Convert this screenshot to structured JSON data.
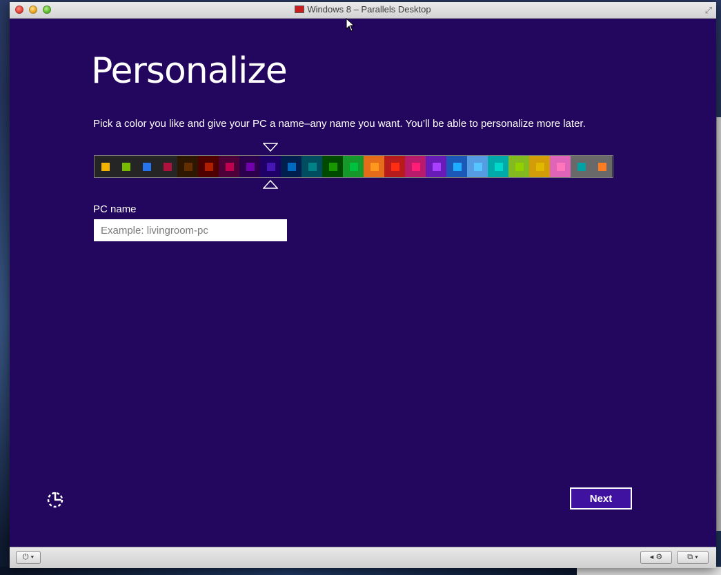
{
  "window": {
    "title": "Windows 8 – Parallels Desktop"
  },
  "page": {
    "heading": "Personalize",
    "subtitle": "Pick a color you like and give your PC a name–any name you want. You’ll be able to personalize more later.",
    "pc_name_label": "PC name",
    "pc_name_value": "",
    "pc_name_placeholder": "Example: livingroom-pc",
    "next_label": "Next",
    "selected_color_index": 8
  },
  "color_swatches": [
    {
      "bg": "#252525",
      "chip": "#f4b300"
    },
    {
      "bg": "#252525",
      "chip": "#78ba00"
    },
    {
      "bg": "#252525",
      "chip": "#2673ec"
    },
    {
      "bg": "#252525",
      "chip": "#ae113d"
    },
    {
      "bg": "#2e1700",
      "chip": "#632f00"
    },
    {
      "bg": "#4e0000",
      "chip": "#b01e00"
    },
    {
      "bg": "#4e0038",
      "chip": "#c1004f"
    },
    {
      "bg": "#2d004e",
      "chip": "#7200ac"
    },
    {
      "bg": "#1f0068",
      "chip": "#4617b4"
    },
    {
      "bg": "#001e4e",
      "chip": "#006ac1"
    },
    {
      "bg": "#004d60",
      "chip": "#008287"
    },
    {
      "bg": "#004a00",
      "chip": "#199900"
    },
    {
      "bg": "#15992a",
      "chip": "#00c13f"
    },
    {
      "bg": "#e56c19",
      "chip": "#ff981d"
    },
    {
      "bg": "#b81b1b",
      "chip": "#ff2e12"
    },
    {
      "bg": "#b81b6c",
      "chip": "#ff1d77"
    },
    {
      "bg": "#691bb8",
      "chip": "#aa40ff"
    },
    {
      "bg": "#1b58b8",
      "chip": "#1faeff"
    },
    {
      "bg": "#569ce3",
      "chip": "#56c5ff"
    },
    {
      "bg": "#00aaaa",
      "chip": "#00d8cc"
    },
    {
      "bg": "#83ba1f",
      "chip": "#91d100"
    },
    {
      "bg": "#d39d09",
      "chip": "#e1b700"
    },
    {
      "bg": "#e064b7",
      "chip": "#ff76bc"
    },
    {
      "bg": "#696969",
      "chip": "#00a3a3"
    },
    {
      "bg": "#696969",
      "chip": "#fe7c22"
    }
  ],
  "colors": {
    "vm_background": "#23065d",
    "next_button": "#3f12a0"
  },
  "icons": {
    "ease_of_access": "ease-of-access-icon",
    "power": "power-icon",
    "settings": "gear-icon",
    "view_mode": "coherence-icon"
  }
}
